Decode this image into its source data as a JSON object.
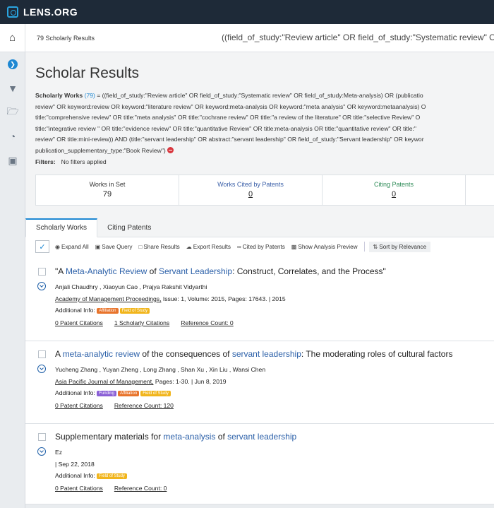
{
  "app": {
    "logo": "LENS.ORG"
  },
  "breadcrumb": {
    "home_icon": "home-icon",
    "crumb": "79 Scholarly Results",
    "query_preview": "((field_of_study:\"Review article\" OR field_of_study:\"Systematic review\" OR"
  },
  "sidebar": {
    "icons": [
      "chevron-right-icon",
      "filter-icon",
      "folder-icon",
      "gauge-icon",
      "save-icon"
    ]
  },
  "page": {
    "title": "Scholar Results",
    "query_label": "Scholarly Works",
    "query_count": "(79)",
    "query_lines": [
      " = ((field_of_study:\"Review article\" OR field_of_study:\"Systematic review\" OR field_of_study:Meta-analysis) OR (publicatio",
      "review\" OR keyword:review OR keyword:\"literature review\" OR keyword:meta-analysis OR keyword:\"meta analysis\" OR keyword:metaanalysis) O",
      "title:\"comprehensive review\" OR title:\"meta analysis\" OR title:\"cochrane review\" OR title:\"a review of the literature\" OR title:\"selective Review\" O",
      "title:\"integrative review \" OR title:\"evidence review\" OR title:\"quantitative Review\" OR title:meta-analysis OR title:\"quantitative review\" OR title:\"",
      "review\" OR title:mini-review)) AND (title:\"servant leadership\" OR abstract:\"servant leadership\" OR field_of_study:\"Servant leadership\" OR keywor",
      "publication_supplementary_type:\"Book Review\")"
    ],
    "filters_label": "Filters:",
    "filters_value": "No filters applied"
  },
  "stats": [
    {
      "label": "Works in Set",
      "value": "79"
    },
    {
      "label": "Works Cited by Patents",
      "value": "0"
    },
    {
      "label": "Citing Patents",
      "value": "0"
    }
  ],
  "tabs": [
    "Scholarly Works",
    "Citing Patents"
  ],
  "toolbar": {
    "expand_all": "Expand All",
    "save_query": "Save Query",
    "share_results": "Share Results",
    "export_results": "Export Results",
    "cited_by_patents": "Cited by Patents",
    "show_analysis_preview": "Show Analysis Preview",
    "sort": "Sort by Relevance"
  },
  "results": [
    {
      "title_parts": [
        "\"A ",
        "Meta-Analytic Review",
        " of ",
        "Servant Leadership",
        ": Construct, Correlates, and the Process\""
      ],
      "authors": "Anjali Chaudhry , Xiaoyun Cao , Prajya Rakshit Vidyarthi",
      "source": "Academy of Management Proceedings,",
      "details": "Issue: 1, Volume: 2015, Pages: 17643. | 2015",
      "additional_label": "Additional Info:",
      "badges": [
        "Affiliation",
        "Field of Study"
      ],
      "patent_citations": "0 Patent Citations",
      "scholarly_citations": "1 Scholarly Citations",
      "reference_count": "Reference Count: 0"
    },
    {
      "title_parts": [
        "A ",
        "meta-analytic review",
        " of the consequences of ",
        "servant leadership",
        ": The moderating roles of cultural factors"
      ],
      "authors": "Yucheng Zhang , Yuyan Zheng , Long Zhang , Shan Xu , Xin Liu , Wansi Chen",
      "source": "Asia Pacific Journal of Management,",
      "details": "Pages: 1-30. | Jun 8, 2019",
      "additional_label": "Additional Info:",
      "badges": [
        "Funding",
        "Affiliation",
        "Field of Study"
      ],
      "patent_citations": "0 Patent Citations",
      "reference_count": "Reference Count: 120"
    },
    {
      "title_parts": [
        "Supplementary materials for ",
        "meta-analysis",
        " of ",
        "servant leadership",
        ""
      ],
      "authors": "Ez",
      "details": "| Sep 22, 2018",
      "additional_label": "Additional Info:",
      "badges": [
        "Field of Study"
      ],
      "patent_citations": "0 Patent Citations",
      "reference_count": "Reference Count: 0"
    }
  ],
  "colors": {
    "topbar": "#1e2a38",
    "accent": "#1e88d3",
    "link": "#2a5fa8",
    "affiliation": "#e8742c",
    "field_of_study": "#f1b51c",
    "funding": "#8a5fd6"
  }
}
